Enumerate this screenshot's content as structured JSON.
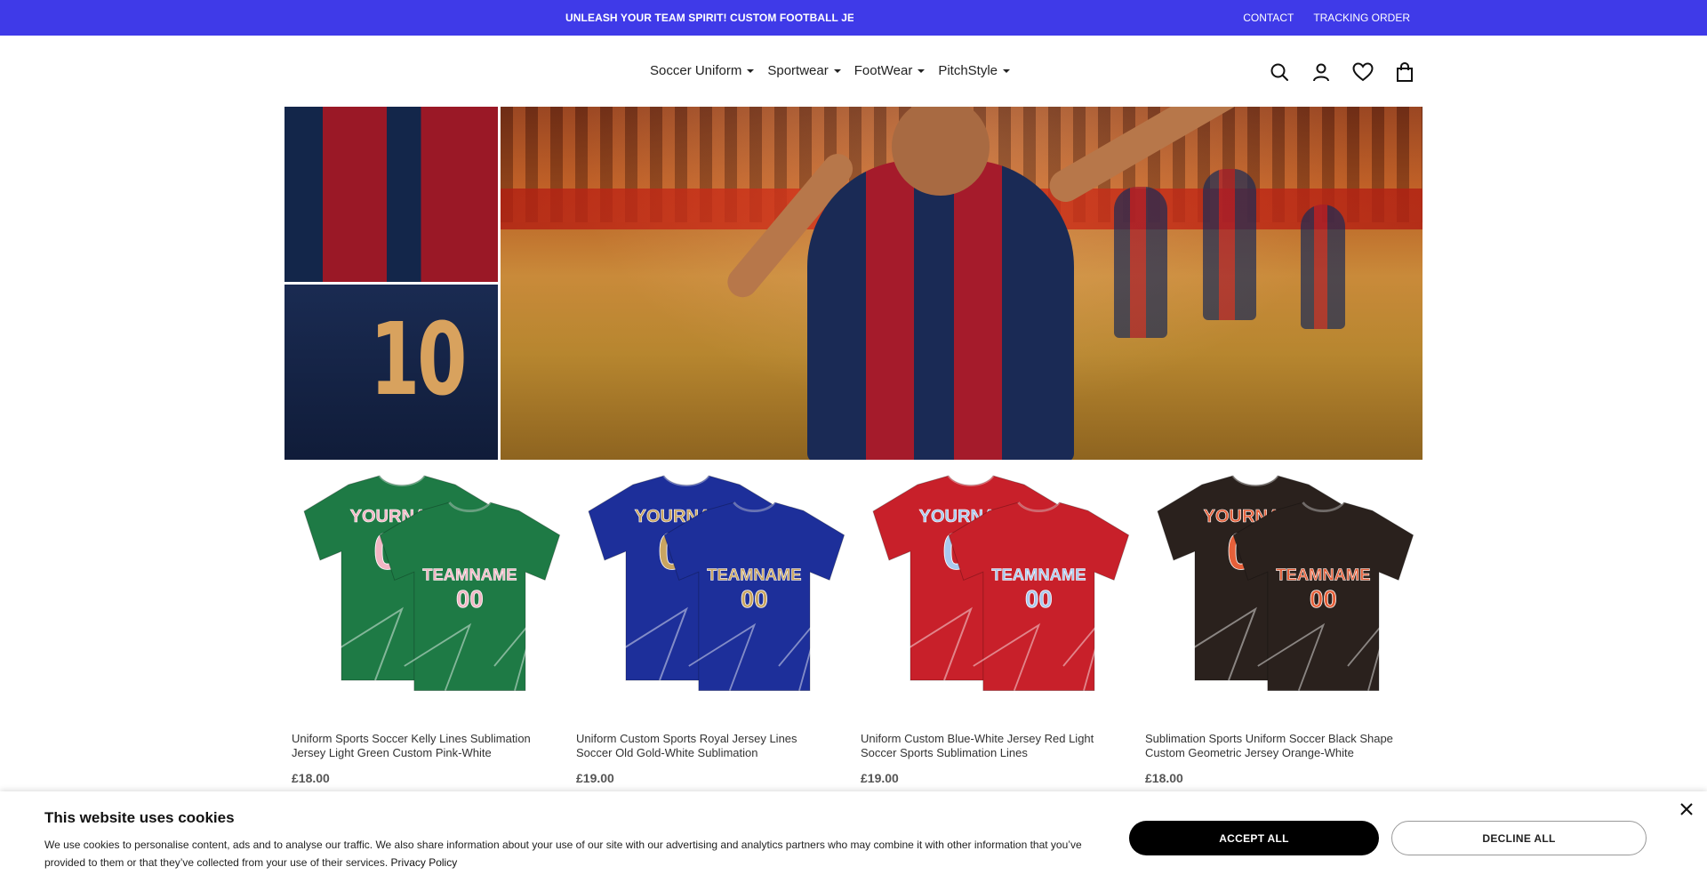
{
  "announcement": {
    "text": "UNLEASH YOUR TEAM SPIRIT! CUSTOM FOOTBALL JERSEYS",
    "links": [
      "CONTACT",
      "TRACKING ORDER"
    ]
  },
  "nav": {
    "items": [
      "Soccer Uniform",
      "Sportwear",
      "FootWear",
      "PitchStyle"
    ]
  },
  "header_icons": [
    "search-icon",
    "account-icon",
    "wishlist-icon",
    "cart-icon"
  ],
  "hero": {
    "jersey_number": "10"
  },
  "products": [
    {
      "name": "Uniform Sports Soccer Kelly Lines Sublimation Jersey Light Green Custom Pink-White",
      "price": "£18.00",
      "body_color": "#1e7a45",
      "text_color": "#f2b6c4",
      "back_label": "YOURNAME",
      "front_label": "TEAMNAME",
      "number": "00"
    },
    {
      "name": "Uniform Custom Sports Royal Jersey Lines Soccer Old Gold-White Sublimation",
      "price": "£19.00",
      "body_color": "#1d2f9a",
      "text_color": "#c9a561",
      "back_label": "YOURNAME",
      "front_label": "TEAMNAME",
      "number": "00"
    },
    {
      "name": "Uniform Custom Blue-White Jersey Red Light Soccer Sports Sublimation Lines",
      "price": "£19.00",
      "body_color": "#c8202a",
      "text_color": "#a9c9ee",
      "back_label": "YOURNAME",
      "front_label": "TEAMNAME",
      "number": "00"
    },
    {
      "name": "Sublimation Sports Uniform Soccer Black Shape Custom Geometric Jersey Orange-White",
      "price": "£18.00",
      "body_color": "#2a211d",
      "text_color": "#e6603a",
      "back_label": "YOURNAME",
      "front_label": "TEAMNAME",
      "number": "00"
    }
  ],
  "cookie": {
    "title": "This website uses cookies",
    "text": "We use cookies to personalise content, ads and to analyse our traffic. We also share information about your use of our site with our advertising and analytics partners who may combine it with other information that you’ve provided to them or that they’ve collected from your use of their services.",
    "privacy_link": "Privacy Policy",
    "accept": "ACCEPT ALL",
    "decline": "DECLINE ALL"
  },
  "colors": {
    "brand": "#3f3ae8"
  }
}
